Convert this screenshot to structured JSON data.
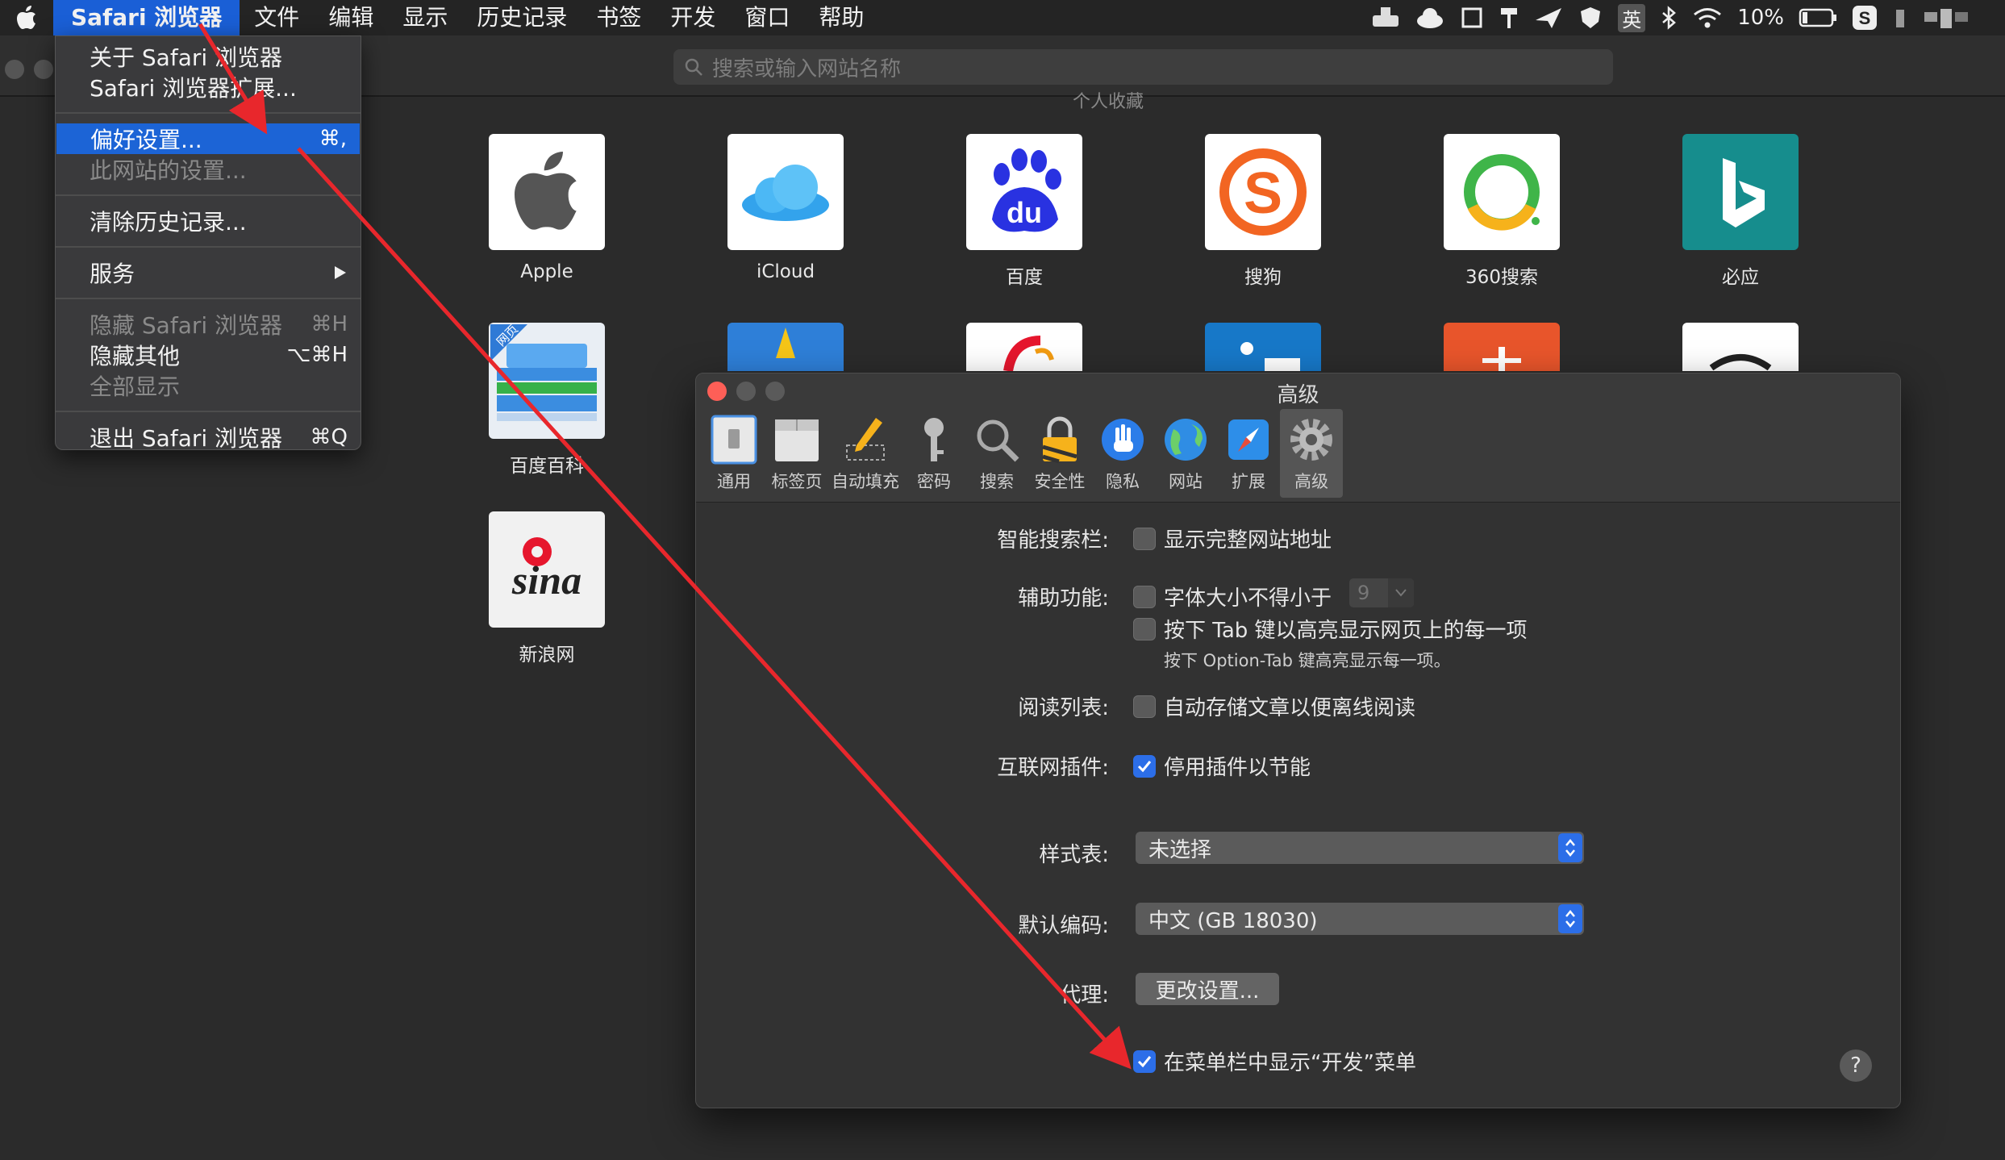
{
  "menubar": {
    "app": "Safari 浏览器",
    "items": [
      "文件",
      "编辑",
      "显示",
      "历史记录",
      "书签",
      "开发",
      "窗口",
      "帮助"
    ],
    "input_method": "英",
    "battery": "10%"
  },
  "toolbar": {
    "url_placeholder": "搜索或输入网站名称"
  },
  "favorites": {
    "heading": "个人收藏",
    "tiles": [
      {
        "label": "Apple",
        "icon": "apple-logo"
      },
      {
        "label": "iCloud",
        "icon": "icloud-logo"
      },
      {
        "label": "百度",
        "icon": "baidu-logo"
      },
      {
        "label": "搜狗",
        "icon": "sogou-logo"
      },
      {
        "label": "360搜索",
        "icon": "360-logo"
      },
      {
        "label": "必应",
        "icon": "bing-logo"
      },
      {
        "label": "百度百科",
        "icon": "baike-logo",
        "badge": "网页"
      },
      {
        "label": "新浪网",
        "icon": "sina-logo",
        "text": "sina"
      }
    ]
  },
  "app_menu": {
    "about": "关于 Safari 浏览器",
    "extensions": "Safari 浏览器扩展...",
    "preferences": "偏好设置...",
    "preferences_shortcut": "⌘,",
    "site_settings": "此网站的设置...",
    "clear_history": "清除历史记录...",
    "services": "服务",
    "hide_safari": "隐藏 Safari 浏览器",
    "hide_safari_shortcut": "⌘H",
    "hide_others": "隐藏其他",
    "hide_others_shortcut": "⌥⌘H",
    "show_all": "全部显示",
    "quit": "退出 Safari 浏览器",
    "quit_shortcut": "⌘Q"
  },
  "prefs": {
    "title": "高级",
    "tabs": [
      "通用",
      "标签页",
      "自动填充",
      "密码",
      "搜索",
      "安全性",
      "隐私",
      "网站",
      "扩展",
      "高级"
    ],
    "active_tab": "高级",
    "smart_search_label": "智能搜索栏:",
    "show_full_address": "显示完整网站地址",
    "accessibility_label": "辅助功能:",
    "min_font_size": "字体大小不得小于",
    "min_font_value": "9",
    "tab_highlight": "按下 Tab 键以高亮显示网页上的每一项",
    "tab_highlight_hint": "按下 Option-Tab 键高亮显示每一项。",
    "reading_list_label": "阅读列表:",
    "save_articles": "自动存储文章以便离线阅读",
    "plugins_label": "互联网插件:",
    "stop_plugins": "停用插件以节能",
    "stylesheet_label": "样式表:",
    "stylesheet_value": "未选择",
    "encoding_label": "默认编码:",
    "encoding_value": "中文 (GB 18030)",
    "proxy_label": "代理:",
    "proxy_button": "更改设置...",
    "develop_menu": "在菜单栏中显示“开发”菜单",
    "help": "?"
  }
}
